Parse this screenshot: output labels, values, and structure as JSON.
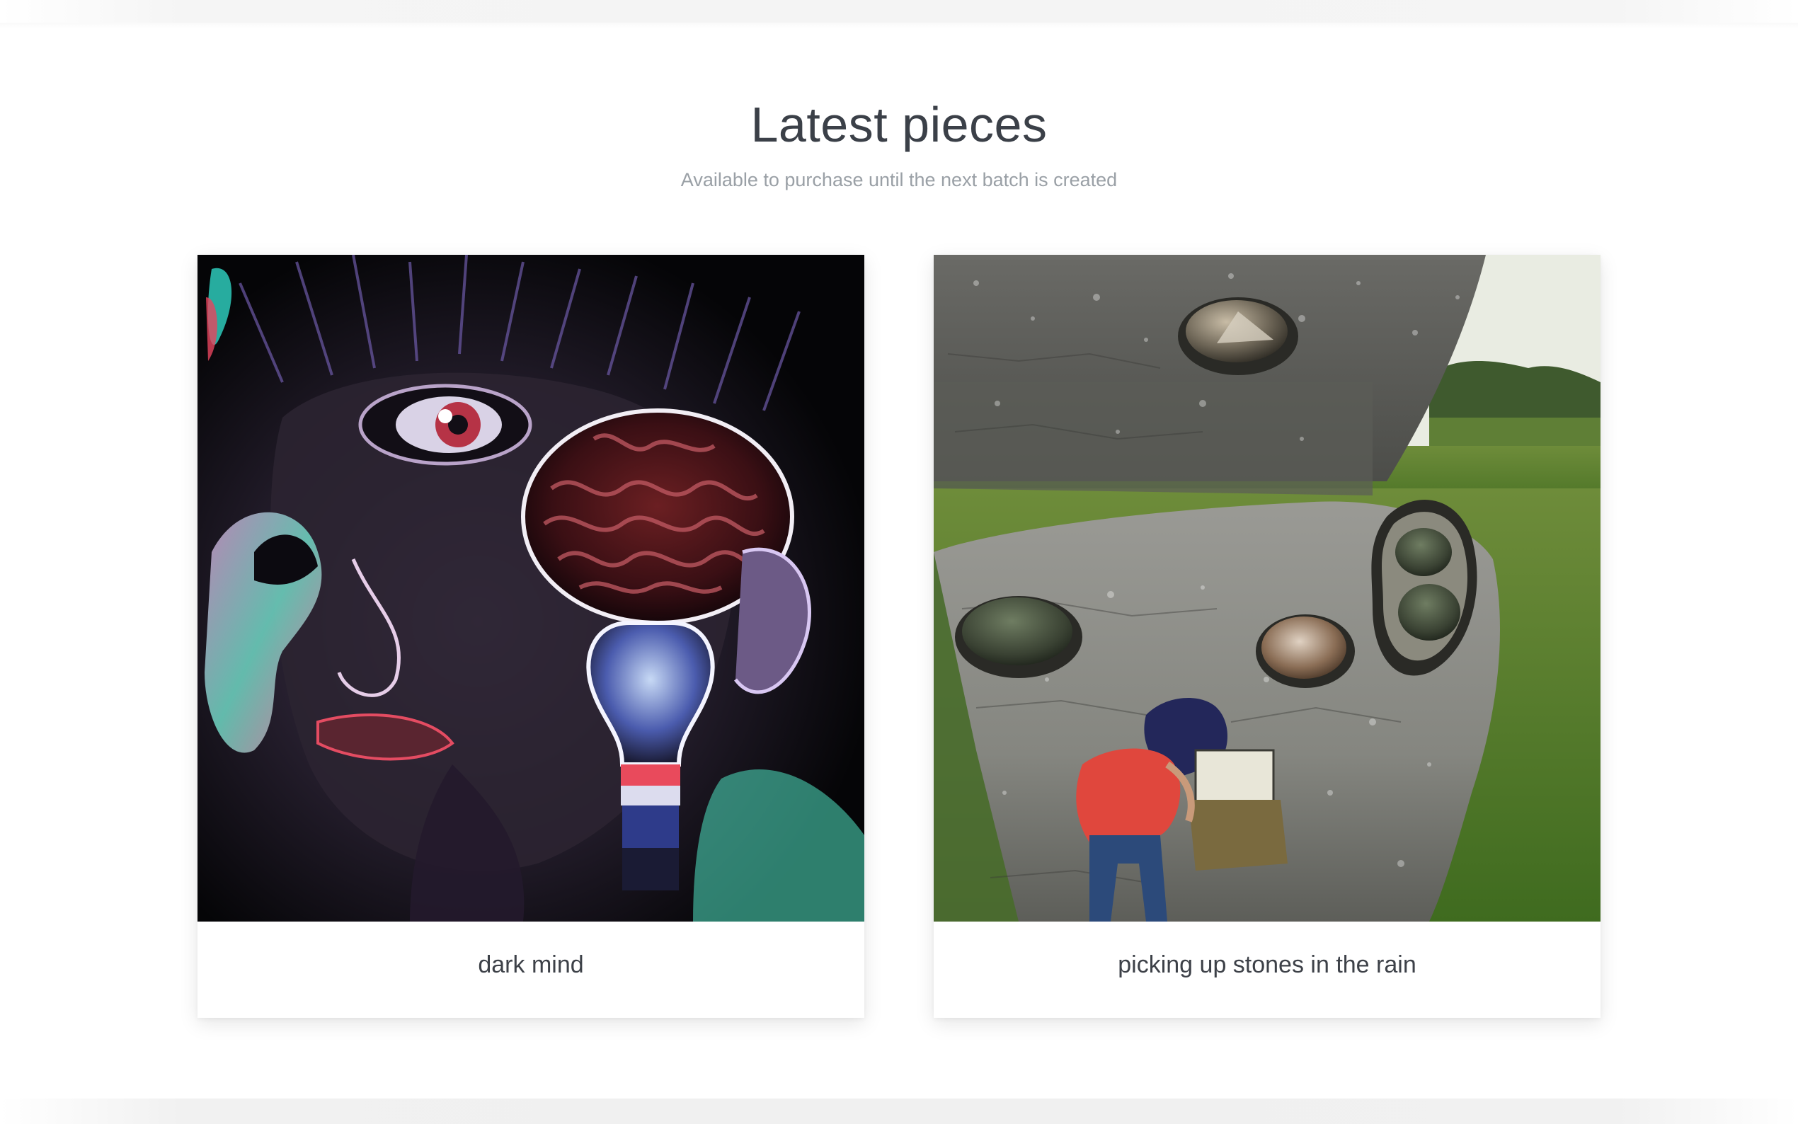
{
  "section": {
    "title": "Latest pieces",
    "subtitle": "Available to purchase until the next batch is created"
  },
  "pieces": [
    {
      "caption": "dark mind",
      "image_icon": "surreal-face-brain-lightbulb-artwork"
    },
    {
      "caption": "picking up stones in the rain",
      "image_icon": "rainy-stones-field-person-artwork"
    }
  ],
  "colors": {
    "title": "#3b4048",
    "subtitle": "#9aa0a6",
    "card_background": "#ffffff"
  }
}
